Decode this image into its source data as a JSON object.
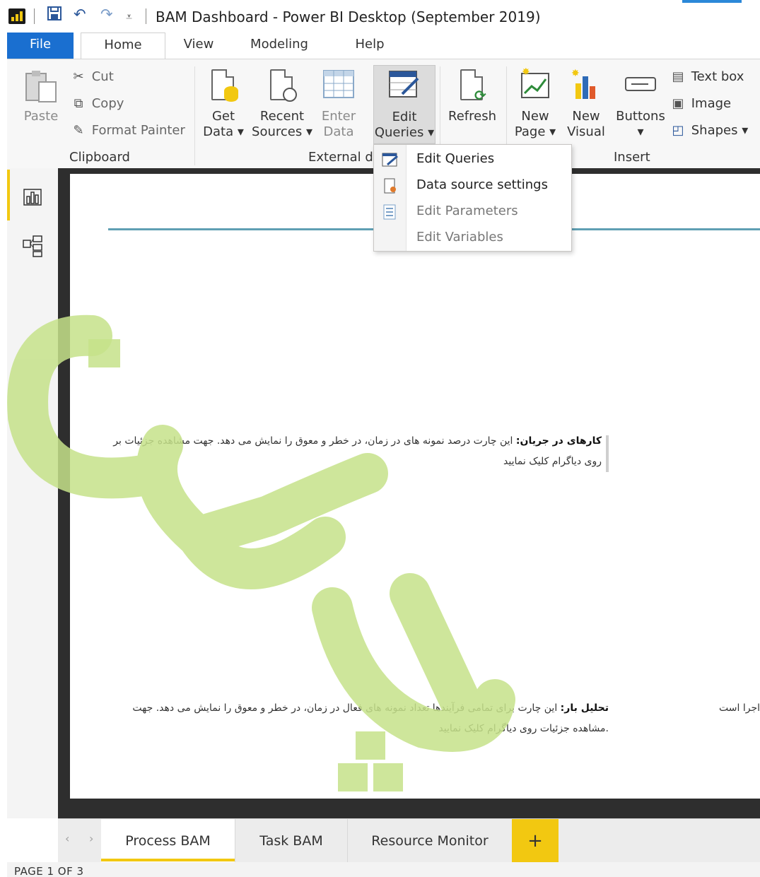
{
  "window": {
    "title": "BAM Dashboard - Power BI Desktop (September 2019)"
  },
  "ribbon_tabs": [
    "File",
    "Home",
    "View",
    "Modeling",
    "Help"
  ],
  "clipboard": {
    "paste": "Paste",
    "cut": "Cut",
    "copy": "Copy",
    "format_painter": "Format Painter",
    "group": "Clipboard"
  },
  "external_data": {
    "get_data": [
      "Get",
      "Data ▾"
    ],
    "recent_sources": [
      "Recent",
      "Sources ▾"
    ],
    "enter_data": [
      "Enter",
      "Data"
    ],
    "edit_queries": [
      "Edit",
      "Queries ▾"
    ],
    "refresh": "Refresh",
    "group": "External da"
  },
  "insert": {
    "new_page": [
      "New",
      "Page ▾"
    ],
    "new_visual": [
      "New",
      "Visual"
    ],
    "buttons": [
      "Buttons",
      "▾"
    ],
    "text_box": "Text box",
    "image": "Image",
    "shapes": "Shapes ▾",
    "group": "Insert"
  },
  "dropdown": {
    "items": [
      {
        "label": "Edit Queries",
        "icon": "edit-queries-icon",
        "enabled": true
      },
      {
        "label": "Data source settings",
        "icon": "data-source-settings-icon",
        "enabled": true
      },
      {
        "label": "Edit Parameters",
        "icon": "edit-parameters-icon",
        "enabled": false
      },
      {
        "label": "Edit Variables",
        "icon": "",
        "enabled": false
      }
    ]
  },
  "canvas": {
    "block1_title": "کارهای در جریان:",
    "block1_line1": "این چارت درصد نمونه های در زمان، در خطر و معوق را نمایش می دهد. جهت مشاهده جزئیات بر",
    "block1_line2": "روی دیاگرام کلیک نمایید",
    "block2_title": "تحلیل بار:",
    "block2_line1": "این چارت برای تمامی فرآیندها تعداد نمونه های فعال در زمان، در خطر و معوق را نمایش می دهد. جهت",
    "block2_line2": ".مشاهده جزئیات روی دیاگرام کلیک نمایید",
    "block3_fragment": "اجرا است"
  },
  "page_tabs": [
    "Process BAM",
    "Task BAM",
    "Resource Monitor"
  ],
  "add_page": "+",
  "status": "PAGE 1 OF 3",
  "colors": {
    "accent": "#f2c811",
    "file_tab": "#1a6fd0",
    "separator_line": "#5f9fb3",
    "watermark": "#c6e28a"
  }
}
